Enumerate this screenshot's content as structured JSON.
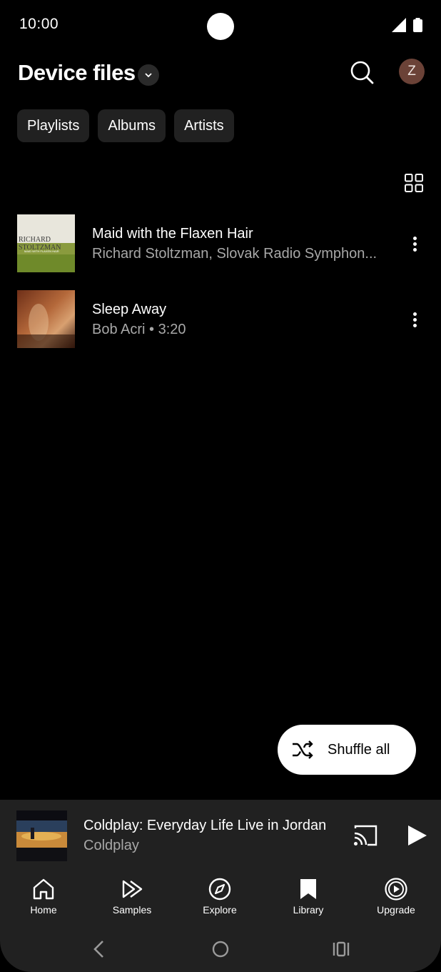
{
  "status_bar": {
    "time": "10:00"
  },
  "header": {
    "title": "Device files",
    "avatar_initial": "Z"
  },
  "chips": [
    {
      "label": "Playlists"
    },
    {
      "label": "Albums"
    },
    {
      "label": "Artists"
    }
  ],
  "tracks": [
    {
      "title": "Maid with the Flaxen Hair",
      "subtitle": "Richard Stoltzman, Slovak Radio Symphon...",
      "art_text_1": "RICHARD",
      "art_text_2": "STOLTZMAN",
      "art_text_3": "MAID WITH FLAXEN HAIR"
    },
    {
      "title": "Sleep Away",
      "subtitle": "Bob Acri • 3:20"
    }
  ],
  "shuffle": {
    "label": "Shuffle all"
  },
  "mini_player": {
    "title": "Coldplay: Everyday Life Live in Jordan",
    "artist": "Coldplay"
  },
  "bottom_nav": [
    {
      "label": "Home",
      "icon": "home-icon"
    },
    {
      "label": "Samples",
      "icon": "samples-icon"
    },
    {
      "label": "Explore",
      "icon": "explore-icon"
    },
    {
      "label": "Library",
      "icon": "library-icon"
    },
    {
      "label": "Upgrade",
      "icon": "upgrade-icon"
    }
  ],
  "colors": {
    "background": "#000000",
    "surface": "#212121",
    "chip": "#212121",
    "secondary_text": "#a8a8a8",
    "avatar": "#6b4237"
  }
}
